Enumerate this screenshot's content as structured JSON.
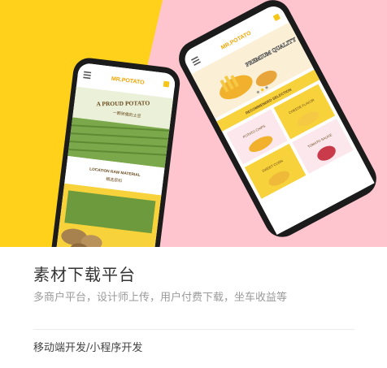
{
  "colors": {
    "yellow_bg": "#FFD11A",
    "pink_bg": "#FFC5CF",
    "phone_body": "#1b1b1b",
    "accent_yellow": "#F5C518",
    "title_text": "#333333",
    "subtitle_text": "#9a9a9a"
  },
  "hero": {
    "left_phone": {
      "logo": "MR.POTATO",
      "slogan": "A PROUD POTATO",
      "slogan_sub": "一颗骄傲的土豆",
      "section_heading": "LOCATION RAW MATERIAL",
      "section_sub": "精选原料",
      "menu_icon": "hamburger-menu-icon",
      "cart_icon": "cart-icon"
    },
    "right_phone": {
      "logo": "MR.POTATO",
      "banner_badge": "PREMIUM QUALITY",
      "section_heading": "RECOMMENDED SELECTION",
      "tiles": [
        "POTATO CHIPS",
        "CHEESE FLAVOR",
        "SWEET CORN",
        "TOMATO SAUCE"
      ],
      "menu_icon": "hamburger-menu-icon",
      "cart_icon": "cart-icon"
    }
  },
  "info": {
    "title": "素材下载平台",
    "subtitle": "多商户平台，设计师上传，用户付费下载，坐车收益等",
    "tag": "移动端开发/小程序开发"
  }
}
